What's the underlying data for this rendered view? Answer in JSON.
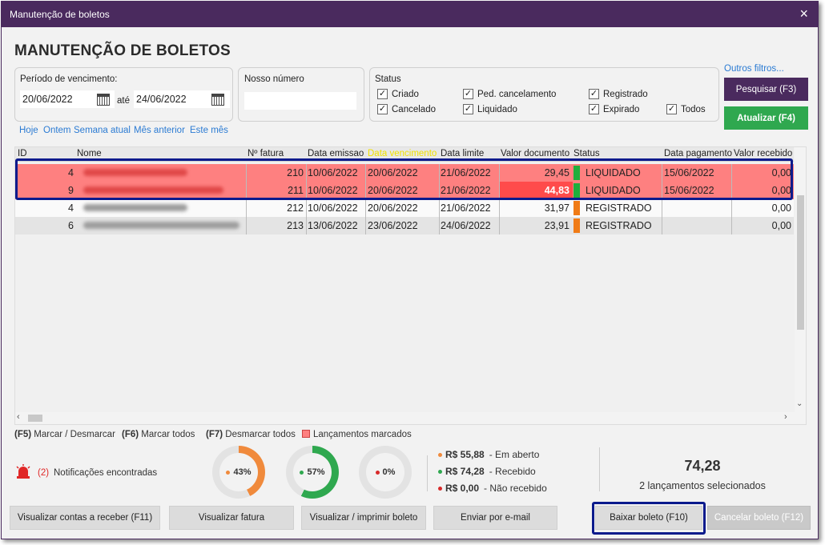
{
  "window": {
    "title": "Manutenção de boletos",
    "close_icon": "×"
  },
  "heading": "MANUTENÇÃO DE BOLETOS",
  "periodo": {
    "label": "Período de vencimento:",
    "from": "20/06/2022",
    "separator": "até",
    "to": "24/06/2022",
    "shortcuts": [
      "Hoje",
      "Ontem",
      "Semana atual",
      "Mês anterior",
      "Este mês"
    ]
  },
  "nosso_numero": {
    "label": "Nosso número",
    "value": ""
  },
  "status": {
    "label": "Status",
    "options": [
      {
        "label": "Criado",
        "checked": true
      },
      {
        "label": "Cancelado",
        "checked": true
      },
      {
        "label": "Ped. cancelamento",
        "checked": true
      },
      {
        "label": "Liquidado",
        "checked": true
      },
      {
        "label": "Registrado",
        "checked": true
      },
      {
        "label": "Expirado",
        "checked": true
      },
      {
        "label": "Todos",
        "checked": true
      }
    ]
  },
  "outros_filtros": "Outros filtros...",
  "buttons": {
    "pesquisar": "Pesquisar (F3)",
    "atualizar": "Atualizar (F4)",
    "contas_receber": "Visualizar contas a receber (F11)",
    "visualizar_fatura": "Visualizar fatura",
    "imprimir_boleto": "Visualizar / imprimir boleto",
    "enviar_email": "Enviar por e-mail",
    "baixar_boleto": "Baixar boleto (F10)",
    "cancelar_boleto": "Cancelar boleto (F12)"
  },
  "table": {
    "columns": [
      "ID",
      "Nome",
      "Nº fatura",
      "Data emissao",
      "Data vencimento",
      "Data limite",
      "Valor documento",
      "Status",
      "Data pagamento",
      "Valor recebido"
    ],
    "rows": [
      {
        "id": "4",
        "fatura": "210",
        "emissao": "10/06/2022",
        "vencimento": "20/06/2022",
        "limite": "21/06/2022",
        "valor": "29,45",
        "status": "LIQUIDADO",
        "pagamento": "15/06/2022",
        "recebido": "0,00",
        "marked": true,
        "status_color": "#1fae3c"
      },
      {
        "id": "9",
        "fatura": "211",
        "emissao": "10/06/2022",
        "vencimento": "20/06/2022",
        "limite": "21/06/2022",
        "valor": "44,83",
        "status": "LIQUIDADO",
        "pagamento": "15/06/2022",
        "recebido": "0,00",
        "marked": true,
        "status_color": "#1fae3c"
      },
      {
        "id": "4",
        "fatura": "212",
        "emissao": "10/06/2022",
        "vencimento": "20/06/2022",
        "limite": "21/06/2022",
        "valor": "31,97",
        "status": "REGISTRADO",
        "pagamento": "",
        "recebido": "0,00",
        "marked": false,
        "status_color": "#f07b16"
      },
      {
        "id": "6",
        "fatura": "213",
        "emissao": "13/06/2022",
        "vencimento": "23/06/2022",
        "limite": "24/06/2022",
        "valor": "23,91",
        "status": "REGISTRADO",
        "pagamento": "",
        "recebido": "0,00",
        "marked": false,
        "status_color": "#f07b16"
      }
    ]
  },
  "legend": {
    "f5_key": "(F5)",
    "f5_text": "Marcar / Desmarcar",
    "f6_key": "(F6)",
    "f6_text": "Marcar todos",
    "f7_key": "(F7)",
    "f7_text": "Desmarcar todos",
    "marked_text": "Lançamentos marcados"
  },
  "notifications": {
    "count": "(2)",
    "text": "Notificações encontradas"
  },
  "donuts": [
    {
      "percent": 43,
      "label": "43%",
      "color": "#f08a3c"
    },
    {
      "percent": 57,
      "label": "57%",
      "color": "#2fa84f"
    },
    {
      "percent": 0,
      "label": "0%",
      "color": "#d82a2a"
    }
  ],
  "summary": [
    {
      "value": "R$ 55,88",
      "label": "- Em aberto",
      "color": "#f08a3c"
    },
    {
      "value": "R$ 74,28",
      "label": "- Recebido",
      "color": "#2fa84f"
    },
    {
      "value": "R$ 0,00",
      "label": "- Não recebido",
      "color": "#d82a2a"
    }
  ],
  "selected": {
    "total": "74,28",
    "text": "2 lançamentos selecionados"
  }
}
